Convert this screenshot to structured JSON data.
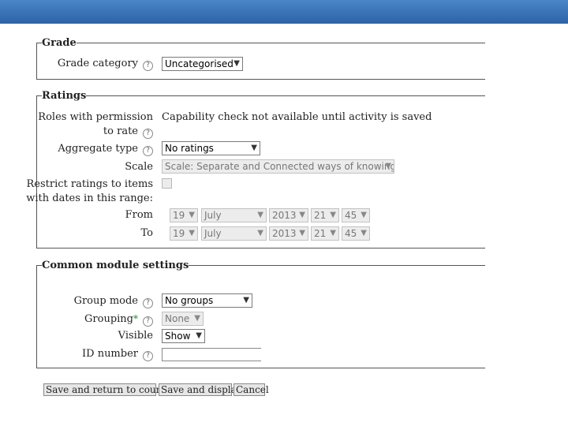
{
  "sections": {
    "grade": {
      "legend": "Grade",
      "grade_category": {
        "label": "Grade category",
        "value": "Uncategorised"
      }
    },
    "ratings": {
      "legend": "Ratings",
      "roles_permission": {
        "label_line1": "Roles with permission",
        "label_line2": "to rate",
        "value": "Capability check not available until activity is saved"
      },
      "aggregate_type": {
        "label": "Aggregate type",
        "value": "No ratings"
      },
      "scale": {
        "label": "Scale",
        "value": "Scale: Separate and Connected ways of knowing"
      },
      "restrict": {
        "label_line1": "Restrict ratings to items",
        "label_line2": "with dates in this range:"
      },
      "from": {
        "label": "From",
        "day": "19",
        "month": "July",
        "year": "2013",
        "hour": "21",
        "minute": "45"
      },
      "to": {
        "label": "To",
        "day": "19",
        "month": "July",
        "year": "2013",
        "hour": "21",
        "minute": "45"
      }
    },
    "common": {
      "legend": "Common module settings",
      "group_mode": {
        "label": "Group mode",
        "value": "No groups"
      },
      "grouping": {
        "label": "Grouping",
        "required_mark": "*",
        "value": "None"
      },
      "visible": {
        "label": "Visible",
        "value": "Show"
      },
      "id_number": {
        "label": "ID number",
        "value": ""
      }
    }
  },
  "buttons": {
    "save_return": "Save and return to course",
    "save_display": "Save and display",
    "cancel": "Cancel"
  },
  "icons": {
    "help": "help-icon",
    "dropdown": "chevron-down-icon"
  },
  "colors": {
    "header_bar": "#2d63a8",
    "required_mark": "#2a8a2a"
  }
}
